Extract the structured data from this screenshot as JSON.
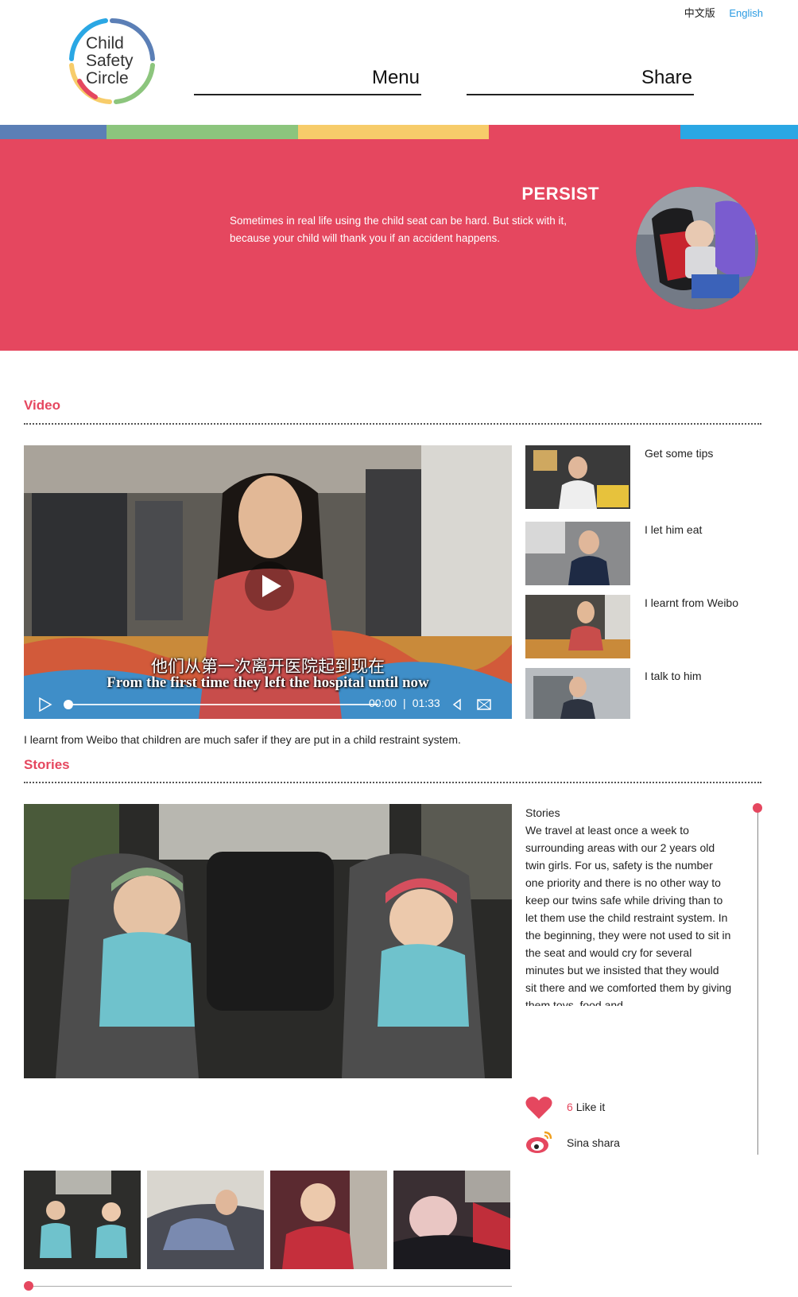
{
  "header": {
    "lang_zh": "中文版",
    "lang_en": "English",
    "logo_lines": [
      "Child",
      "Safety",
      "Circle"
    ],
    "nav_menu": "Menu",
    "nav_share": "Share"
  },
  "colors": {
    "brand_red": "#e5475f",
    "stripe": [
      "#5b7fb6",
      "#8cc57d",
      "#f7cc6a",
      "#e5475f",
      "#2aa7e4"
    ],
    "link_blue": "#2a9be2"
  },
  "hero": {
    "title": "PERSIST",
    "text": "Sometimes in real life using the child seat can be hard. But stick with it, because your child will thank you if an accident happens."
  },
  "video_section": {
    "title": "Video",
    "subtitle_zh": "他们从第一次离开医院起到现在",
    "subtitle_en": "From the first time they left the hospital until now",
    "time_current": "00:00",
    "time_separator": "|",
    "time_total": "01:33",
    "playlist": [
      {
        "label": "Get some tips"
      },
      {
        "label": "I let him eat"
      },
      {
        "label": "I learnt from Weibo"
      },
      {
        "label": "I talk to him"
      }
    ],
    "caption": "I learnt from Weibo that children are much safer if they are put in a child restraint system."
  },
  "stories_section": {
    "title": "Stories",
    "text_heading": "Stories",
    "text_body": "We travel at least once a week to surrounding areas with our 2 years old twin girls. For us, safety is the number one priority and there is no other way to keep our twins safe while driving than to let them use the child restraint system. In the beginning, they were not used to sit in the seat and would cry for several minutes but we insisted that they would sit there and we comforted them by giving them toys, food and",
    "like_count": "6",
    "like_label": "Like it",
    "share_label": "Sina shara"
  }
}
